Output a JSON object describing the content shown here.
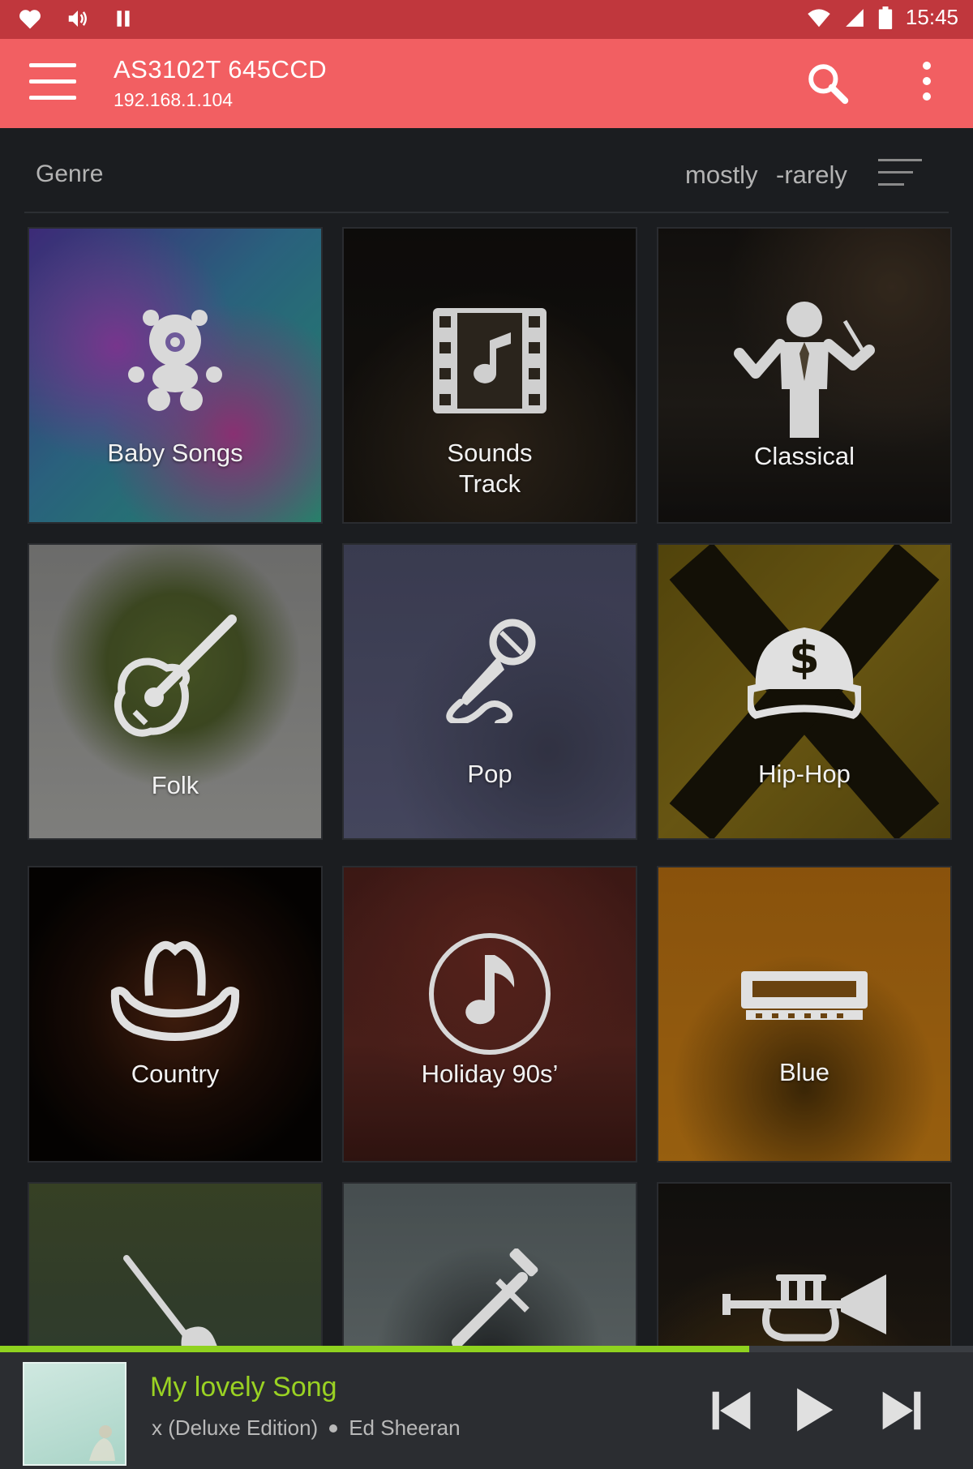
{
  "status_bar": {
    "time": "15:45",
    "left_icons": [
      "heart-icon",
      "volume-icon",
      "pause-icon"
    ],
    "right_icons": [
      "wifi-icon",
      "signal-icon",
      "battery-icon"
    ]
  },
  "toolbar": {
    "device_name": "AS3102T 645CCD",
    "device_ip": "192.168.1.104",
    "menu_icon": "hamburger-menu-icon",
    "search_icon": "search-icon",
    "more_icon": "more-vertical-icon",
    "accent_color": "#f25f62"
  },
  "sort_bar": {
    "title": "Genre",
    "sort_mostly": "mostly",
    "sort_rarely": "-rarely",
    "sort_icon": "sort-icon"
  },
  "genres": [
    {
      "label": "Baby Songs",
      "icon": "teddy-bear-icon"
    },
    {
      "label": "Sounds\nTrack",
      "icon": "film-music-icon"
    },
    {
      "label": "Classical",
      "icon": "conductor-icon"
    },
    {
      "label": "Folk",
      "icon": "acoustic-guitar-icon"
    },
    {
      "label": "Pop",
      "icon": "microphone-icon"
    },
    {
      "label": "Hip-Hop",
      "icon": "dollar-cap-icon"
    },
    {
      "label": "Country",
      "icon": "cowboy-hat-icon"
    },
    {
      "label": "Holiday 90s’",
      "icon": "music-note-circle-icon"
    },
    {
      "label": "Blue",
      "icon": "harmonica-icon"
    },
    {
      "label": "",
      "icon": "electric-guitar-icon"
    },
    {
      "label": "",
      "icon": "saxophone-icon"
    },
    {
      "label": "",
      "icon": "trumpet-icon"
    }
  ],
  "player": {
    "song_title": "My lovely Song",
    "album": "x (Deluxe Edition)",
    "artist": "Ed Sheeran",
    "progress": 0.77,
    "progress_color": "#8fd21f",
    "controls": [
      "previous-icon",
      "play-icon",
      "next-icon"
    ]
  }
}
